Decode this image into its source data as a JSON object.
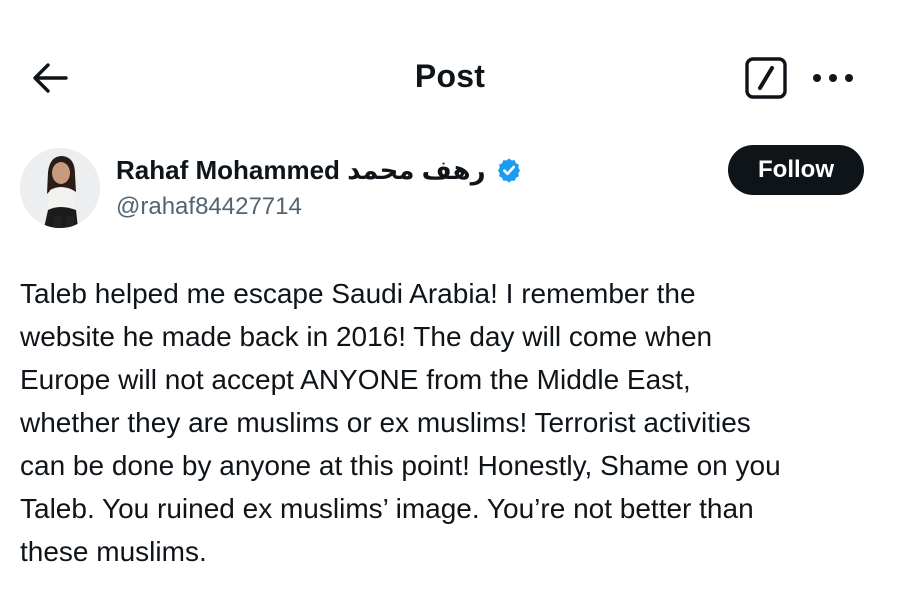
{
  "header": {
    "title": "Post",
    "back_icon": "arrow-left-icon",
    "edit_icon": "edit-square-icon",
    "more_icon": "more-horizontal-icon"
  },
  "author": {
    "display_name": "Rahaf Mohammed رهف محمد",
    "handle": "@rahaf84427714",
    "verified_icon": "verified-badge-icon",
    "verified_color": "#1d9bf0"
  },
  "actions": {
    "follow_label": "Follow"
  },
  "post": {
    "text": "Taleb helped me escape Saudi Arabia! I remember the\nwebsite he made back in 2016! The day will come when\nEurope will not accept ANYONE from the Middle East,\nwhether they are muslims or ex muslims! Terrorist activities\ncan be done by anyone at this point! Honestly, Shame on you\nTaleb. You ruined ex muslims’ image. You’re not better than\nthese muslims."
  }
}
